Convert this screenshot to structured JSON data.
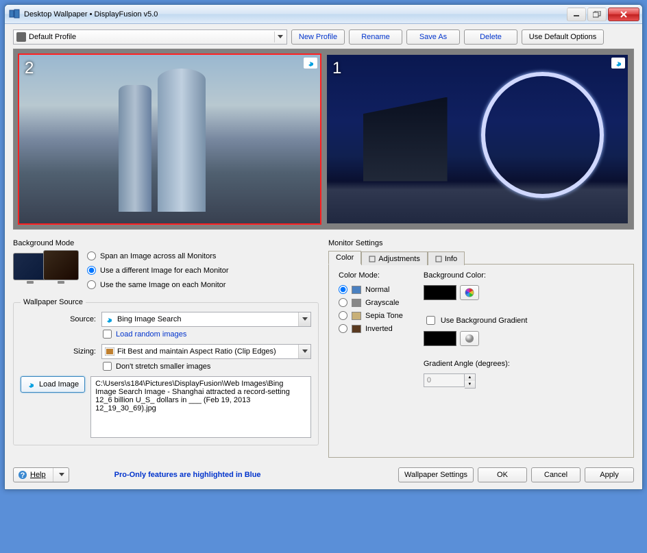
{
  "window": {
    "title": "Desktop Wallpaper • DisplayFusion v5.0"
  },
  "profile": {
    "selected": "Default Profile",
    "buttons": {
      "new": "New Profile",
      "rename": "Rename",
      "saveas": "Save As",
      "delete": "Delete",
      "defaults": "Use Default Options"
    }
  },
  "monitors": [
    {
      "number": "2"
    },
    {
      "number": "1"
    }
  ],
  "backgroundMode": {
    "title": "Background Mode",
    "options": [
      {
        "label": "Span an Image across all Monitors",
        "checked": false
      },
      {
        "label": "Use a different Image for each Monitor",
        "checked": true
      },
      {
        "label": "Use the same Image on each Monitor",
        "checked": false
      }
    ]
  },
  "wallpaperSource": {
    "title": "Wallpaper Source",
    "sourceLabel": "Source:",
    "sourceValue": "Bing Image Search",
    "loadRandom": "Load random images",
    "sizingLabel": "Sizing:",
    "sizingValue": "Fit Best and maintain Aspect Ratio (Clip Edges)",
    "dontStretch": "Don't stretch smaller images",
    "loadImage": "Load Image",
    "path": "C:\\Users\\s184\\Pictures\\DisplayFusion\\Web Images\\Bing Image Search Image - Shanghai attracted a record-setting 12_6 billion U_S_ dollars in ___ (Feb 19, 2013 12_19_30_69).jpg"
  },
  "monitorSettings": {
    "title": "Monitor Settings",
    "tabs": {
      "color": "Color",
      "adjustments": "Adjustments",
      "info": "Info"
    },
    "colorMode": {
      "label": "Color Mode:",
      "options": [
        {
          "label": "Normal",
          "color": "#4a80c0",
          "checked": true
        },
        {
          "label": "Grayscale",
          "color": "#888888",
          "checked": false
        },
        {
          "label": "Sepia Tone",
          "color": "#c8b078",
          "checked": false
        },
        {
          "label": "Inverted",
          "color": "#5a3a20",
          "checked": false
        }
      ]
    },
    "bgColor": {
      "label": "Background Color:"
    },
    "useGradient": "Use Background Gradient",
    "gradientAngle": {
      "label": "Gradient Angle (degrees):",
      "value": "0"
    }
  },
  "footer": {
    "help": "Help",
    "proNote": "Pro-Only features are highlighted in Blue",
    "wallpaperSettings": "Wallpaper Settings",
    "ok": "OK",
    "cancel": "Cancel",
    "apply": "Apply"
  }
}
